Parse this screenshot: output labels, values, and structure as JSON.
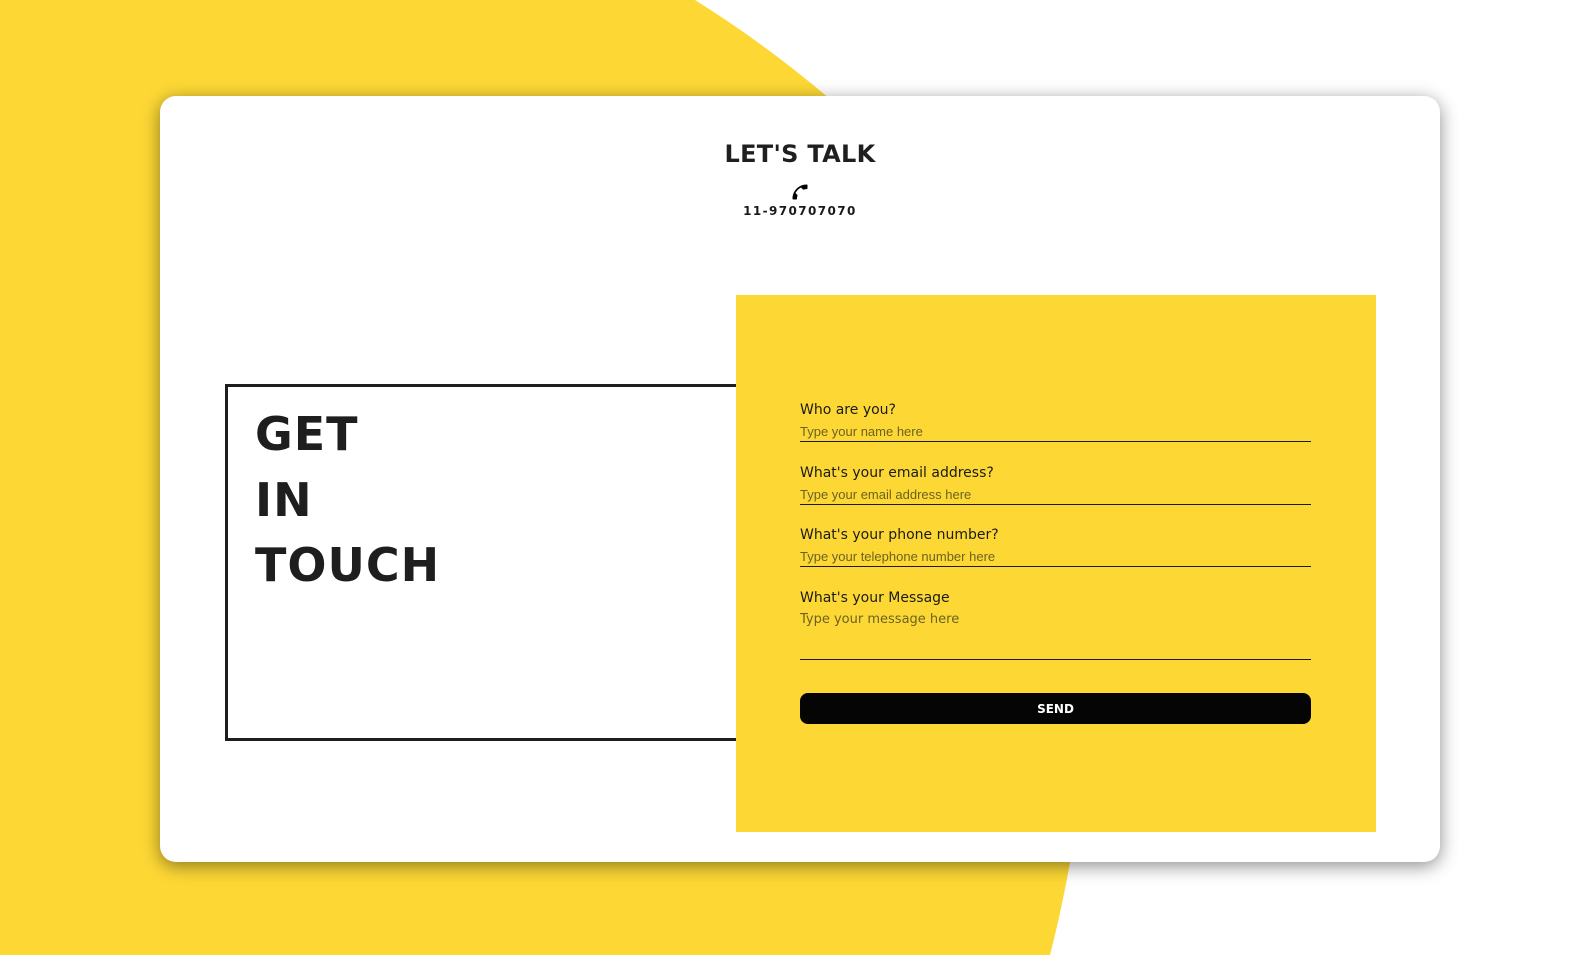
{
  "header": {
    "title": "LET'S TALK",
    "phone_number": "11-970707070"
  },
  "hero": {
    "lines": [
      "GET",
      "IN",
      "TOUCH"
    ]
  },
  "form": {
    "name": {
      "label": "Who are you?",
      "placeholder": "Type your name here"
    },
    "email": {
      "label": "What's your email address?",
      "placeholder": "Type your email address here"
    },
    "phone": {
      "label": "What's your phone number?",
      "placeholder": "Type your telephone number here"
    },
    "message": {
      "label": "What's your Message",
      "placeholder": "Type your message here"
    },
    "send_label": "SEND"
  },
  "colors": {
    "accent": "#fdd835",
    "text": "#1e1e1e",
    "button": "#050505"
  }
}
